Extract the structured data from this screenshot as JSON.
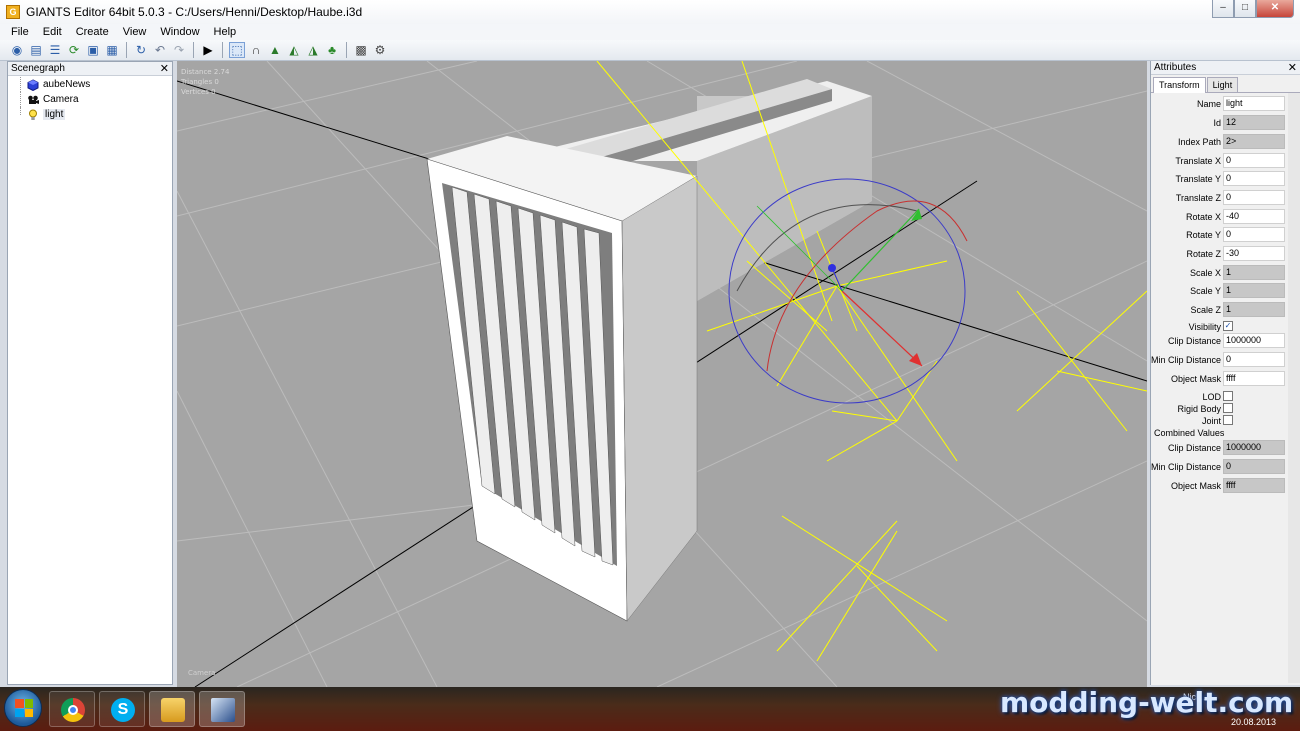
{
  "window": {
    "title": "GIANTS Editor 64bit 5.0.3 - C:/Users/Henni/Desktop/Haube.i3d",
    "app_icon_letter": "G",
    "minimize": "–",
    "maximize": "□",
    "close": "✕"
  },
  "menu": [
    "File",
    "Edit",
    "Create",
    "View",
    "Window",
    "Help"
  ],
  "toolbar_icons": [
    "new-icon",
    "open-icon",
    "list-icon",
    "refresh-icon",
    "save-icon",
    "save-all-icon",
    "reload-icon",
    "undo-icon",
    "redo-icon",
    "play-icon",
    "select-icon",
    "magnet-icon",
    "terrain-icon",
    "terrain-paint-icon",
    "terrain-sculpt-icon",
    "foliage-icon",
    "checker-icon",
    "settings-icon"
  ],
  "scenegraph": {
    "title": "Scenegraph",
    "close": "✕",
    "items": [
      {
        "label": "aubeNews",
        "icon": "cube-icon"
      },
      {
        "label": "Camera",
        "icon": "camera-icon"
      },
      {
        "label": "light",
        "icon": "light-bulb-icon"
      }
    ]
  },
  "viewport": {
    "stats": [
      "Distance 2.74",
      "Triangles 0",
      "Vertices 0"
    ],
    "camera_label": "Camera"
  },
  "attributes": {
    "title": "Attributes",
    "close": "✕",
    "tabs": [
      "Transform",
      "Light"
    ],
    "fields": [
      {
        "label": "Name",
        "value": "light",
        "readonly": false
      },
      {
        "label": "Id",
        "value": "12",
        "readonly": true
      },
      {
        "label": "Index Path",
        "value": "2>",
        "readonly": true
      },
      {
        "label": "Translate X",
        "value": "0",
        "readonly": false
      },
      {
        "label": "Translate Y",
        "value": "0",
        "readonly": false
      },
      {
        "label": "Translate Z",
        "value": "0",
        "readonly": false
      },
      {
        "label": "Rotate X",
        "value": "-40",
        "readonly": false
      },
      {
        "label": "Rotate Y",
        "value": "0",
        "readonly": false
      },
      {
        "label": "Rotate Z",
        "value": "-30",
        "readonly": false
      },
      {
        "label": "Scale X",
        "value": "1",
        "readonly": true
      },
      {
        "label": "Scale Y",
        "value": "1",
        "readonly": true
      },
      {
        "label": "Scale Z",
        "value": "1",
        "readonly": true
      }
    ],
    "visibility": {
      "label": "Visibility",
      "checked": true
    },
    "clip_distance": {
      "label": "Clip Distance",
      "value": "1000000"
    },
    "min_clip_distance": {
      "label": "Min Clip Distance",
      "value": "0"
    },
    "object_mask": {
      "label": "Object Mask",
      "value": "ffff"
    },
    "lod": {
      "label": "LOD",
      "checked": false
    },
    "rigid_body": {
      "label": "Rigid Body",
      "checked": false
    },
    "joint": {
      "label": "Joint",
      "checked": false
    },
    "combined_title": "Combined Values",
    "combined": [
      {
        "label": "Clip Distance",
        "value": "1000000"
      },
      {
        "label": "Min Clip Distance",
        "value": "0"
      },
      {
        "label": "Object Mask",
        "value": "ffff"
      }
    ]
  },
  "taskbar": {
    "apps": [
      "chrome-icon",
      "skype-icon",
      "files-icon",
      "giants-editor-icon"
    ],
    "watermark": "modding-welt.com",
    "date": "20.08.2013",
    "tray_text": "Nick..."
  },
  "colors": {
    "viewport_bg": "#a5a5a5",
    "grid": "#bcbcbc",
    "axis_black": "#000000",
    "light_gizmo": "#ffff00",
    "gizmo_x": "#e03030",
    "gizmo_y": "#30c030",
    "gizmo_z": "#3030e0"
  }
}
